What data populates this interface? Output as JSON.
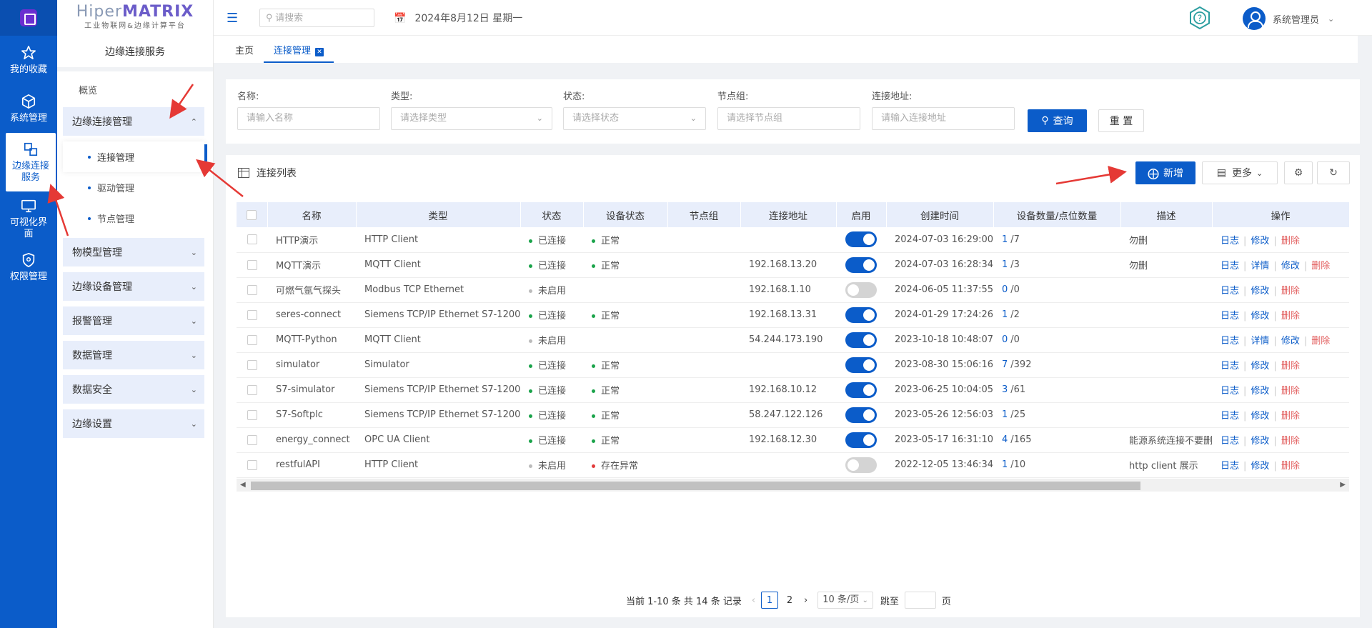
{
  "brand": {
    "name_prefix": "Hiper",
    "name_suffix": "MATRIX",
    "subtitle": "工业物联网&边缘计算平台"
  },
  "rail": {
    "items": [
      {
        "label": "我的收藏",
        "icon": "star-icon"
      },
      {
        "label": "系统管理",
        "icon": "cube-icon"
      },
      {
        "label": "边缘连接服务",
        "icon": "edge-icon"
      },
      {
        "label": "可视化界面",
        "icon": "monitor-icon"
      },
      {
        "label": "权限管理",
        "icon": "shield-icon"
      }
    ]
  },
  "sidebar": {
    "section_title": "边缘连接服务",
    "overview": "概览",
    "groups": [
      {
        "label": "边缘连接管理",
        "expanded": true
      },
      {
        "label": "物模型管理"
      },
      {
        "label": "边缘设备管理"
      },
      {
        "label": "报警管理"
      },
      {
        "label": "数据管理"
      },
      {
        "label": "数据安全"
      },
      {
        "label": "边缘设置"
      }
    ],
    "sub_items": [
      "连接管理",
      "驱动管理",
      "节点管理"
    ]
  },
  "topbar": {
    "search_placeholder": "请搜索",
    "date": "2024年8月12日 星期一",
    "user": "系统管理员"
  },
  "tabs": [
    {
      "label": "主页"
    },
    {
      "label": "连接管理"
    }
  ],
  "filters": {
    "name": {
      "label": "名称:",
      "placeholder": "请输入名称"
    },
    "type": {
      "label": "类型:",
      "placeholder": "请选择类型"
    },
    "status": {
      "label": "状态:",
      "placeholder": "请选择状态"
    },
    "node_group": {
      "label": "节点组:",
      "placeholder": "请选择节点组"
    },
    "address": {
      "label": "连接地址:",
      "placeholder": "请输入连接地址"
    },
    "query_label": "查询",
    "reset_label": "重 置"
  },
  "list": {
    "title": "连接列表",
    "add_label": "新增",
    "more_label": "更多",
    "columns": [
      "名称",
      "类型",
      "状态",
      "设备状态",
      "节点组",
      "连接地址",
      "启用",
      "创建时间",
      "设备数量/点位数量",
      "描述",
      "操作"
    ],
    "rows": [
      {
        "name": "HTTP演示",
        "type": "HTTP Client",
        "status": "已连接",
        "dev_status": "正常",
        "group": "",
        "addr": "",
        "enabled": true,
        "created": "2024-07-03 16:29:00",
        "dev": "1",
        "pts": "/7",
        "desc": "勿删",
        "ops": [
          "日志",
          "修改",
          "删除"
        ]
      },
      {
        "name": "MQTT演示",
        "type": "MQTT Client",
        "status": "已连接",
        "dev_status": "正常",
        "group": "",
        "addr": "192.168.13.20",
        "enabled": true,
        "created": "2024-07-03 16:28:34",
        "dev": "1",
        "pts": "/3",
        "desc": "勿删",
        "ops": [
          "日志",
          "详情",
          "修改",
          "删除"
        ]
      },
      {
        "name": "可燃气氩气探头",
        "type": "Modbus TCP Ethernet",
        "status": "未启用",
        "dev_status": "",
        "group": "",
        "addr": "192.168.1.10",
        "enabled": false,
        "created": "2024-06-05 11:37:55",
        "dev": "0",
        "pts": "/0",
        "desc": "",
        "ops": [
          "日志",
          "修改",
          "删除"
        ]
      },
      {
        "name": "seres-connect",
        "type": "Siemens TCP/IP Ethernet S7-1200",
        "status": "已连接",
        "dev_status": "正常",
        "group": "",
        "addr": "192.168.13.31",
        "enabled": true,
        "created": "2024-01-29 17:24:26",
        "dev": "1",
        "pts": "/2",
        "desc": "",
        "ops": [
          "日志",
          "修改",
          "删除"
        ]
      },
      {
        "name": "MQTT-Python",
        "type": "MQTT Client",
        "status": "未启用",
        "dev_status": "",
        "group": "",
        "addr": "54.244.173.190",
        "enabled": true,
        "created": "2023-10-18 10:48:07",
        "dev": "0",
        "pts": "/0",
        "desc": "",
        "ops": [
          "日志",
          "详情",
          "修改",
          "删除"
        ]
      },
      {
        "name": "simulator",
        "type": "Simulator",
        "status": "已连接",
        "dev_status": "正常",
        "group": "",
        "addr": "",
        "enabled": true,
        "created": "2023-08-30 15:06:16",
        "dev": "7",
        "pts": "/392",
        "desc": "",
        "ops": [
          "日志",
          "修改",
          "删除"
        ]
      },
      {
        "name": "S7-simulator",
        "type": "Siemens TCP/IP Ethernet S7-1200",
        "status": "已连接",
        "dev_status": "正常",
        "group": "",
        "addr": "192.168.10.12",
        "enabled": true,
        "created": "2023-06-25 10:04:05",
        "dev": "3",
        "pts": "/61",
        "desc": "",
        "ops": [
          "日志",
          "修改",
          "删除"
        ]
      },
      {
        "name": "S7-Softplc",
        "type": "Siemens TCP/IP Ethernet S7-1200",
        "status": "已连接",
        "dev_status": "正常",
        "group": "",
        "addr": "58.247.122.126",
        "enabled": true,
        "created": "2023-05-26 12:56:03",
        "dev": "1",
        "pts": "/25",
        "desc": "",
        "ops": [
          "日志",
          "修改",
          "删除"
        ]
      },
      {
        "name": "energy_connect",
        "type": "OPC UA Client",
        "status": "已连接",
        "dev_status": "正常",
        "group": "",
        "addr": "192.168.12.30",
        "enabled": true,
        "created": "2023-05-17 16:31:10",
        "dev": "4",
        "pts": "/165",
        "desc": "能源系统连接不要删",
        "ops": [
          "日志",
          "修改",
          "删除"
        ]
      },
      {
        "name": "restfulAPI",
        "type": "HTTP Client",
        "status": "未启用",
        "dev_status": "存在异常",
        "group": "",
        "addr": "",
        "enabled": false,
        "created": "2022-12-05 13:46:34",
        "dev": "1",
        "pts": "/10",
        "desc": "http client 展示",
        "ops": [
          "日志",
          "修改",
          "删除"
        ]
      }
    ]
  },
  "pagination": {
    "summary": "当前 1-10 条 共 14 条 记录",
    "pages": [
      "1",
      "2"
    ],
    "current": "1",
    "page_size": "10 条/页",
    "jump_label": "跳至",
    "page_unit": "页"
  },
  "colors": {
    "primary": "#0b5cc9",
    "ok": "#1aa34a",
    "idle": "#bbbbbb",
    "error": "#e23b3b",
    "danger": "#e25c5c",
    "annotation": "#e53935"
  }
}
